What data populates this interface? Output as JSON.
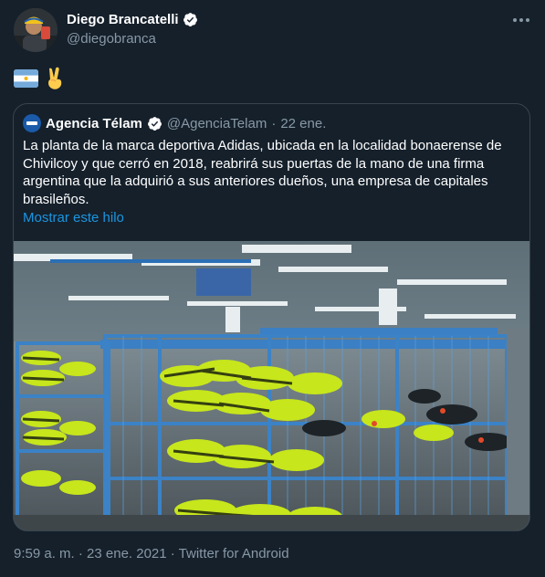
{
  "tweet": {
    "author_name": "Diego Brancatelli",
    "author_handle": "@diegobranca",
    "emojis": [
      "argentina-flag",
      "victory-hand"
    ],
    "quoted": {
      "name": "Agencia Télam",
      "handle": "@AgenciaTelam",
      "separator": "·",
      "date": "22 ene.",
      "text": "La planta de la marca deportiva Adidas, ubicada en la localidad bonaerense de Chivilcoy y que cerró en 2018, reabrirá sus puertas de la mano de una firma argentina que la adquirió a sus anteriores dueños, una empresa de capitales brasileños.",
      "show_thread": "Mostrar este hilo"
    },
    "timestamp": "9:59 a. m. · 23 ene. 2021 · Twitter for Android"
  },
  "colors": {
    "background": "#15202b",
    "link": "#1b95e0",
    "muted": "#8899a6",
    "border": "#38444d"
  }
}
